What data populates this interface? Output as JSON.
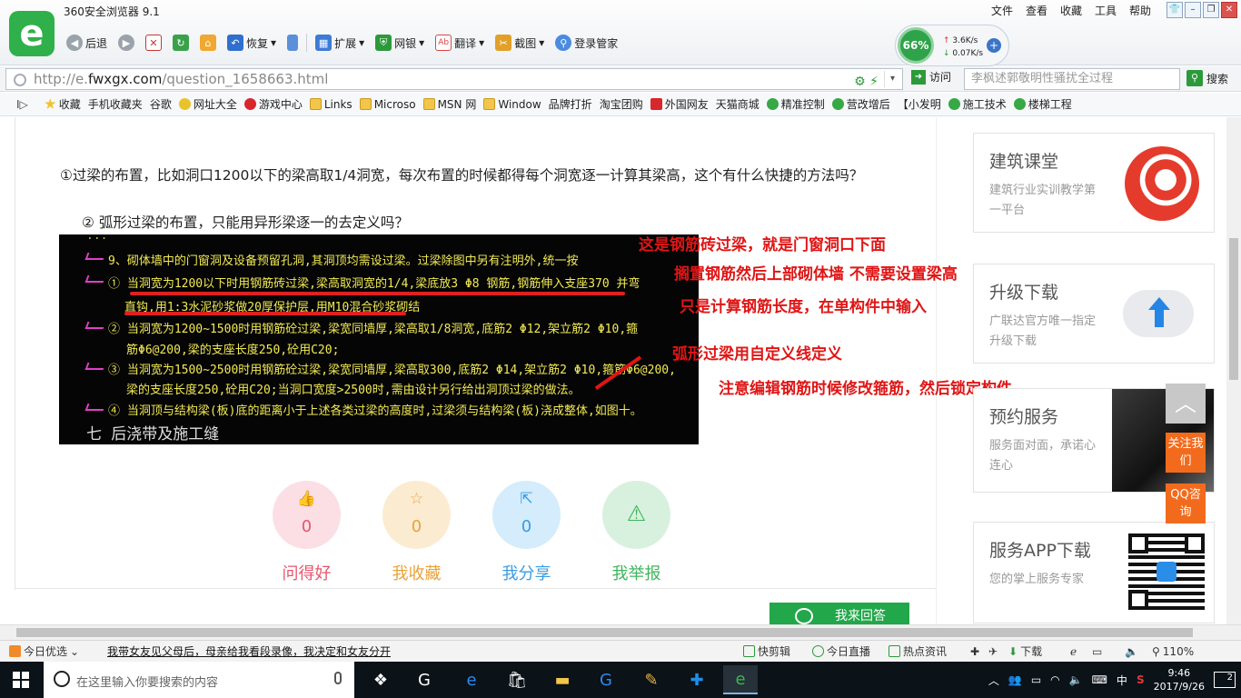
{
  "browser": {
    "title": "360安全浏览器 9.1",
    "menu": [
      "文件",
      "查看",
      "收藏",
      "工具",
      "帮助"
    ],
    "toolbar": {
      "back": "后退",
      "restore": "恢复",
      "extensions": "扩展",
      "bank": "网银",
      "translate": "翻译",
      "screenshot": "截图",
      "login": "登录管家"
    },
    "speed": {
      "percent": "66%",
      "up": "3.6K/s",
      "down": "0.07K/s"
    },
    "address": {
      "prefix": "http://e.",
      "domain": "fwxgx.com",
      "path": "/question_1658663.html"
    },
    "visit": "访问",
    "search_placeholder": "李枫述郭敬明性骚扰全过程",
    "search_button": "搜索",
    "favorites": [
      "收藏",
      "手机收藏夹",
      "谷歌",
      "网址大全",
      "游戏中心",
      "Links",
      "Microso",
      "MSN 网",
      "Window",
      "品牌打折",
      "淘宝团购",
      "外国网友",
      "天猫商城",
      "精准控制",
      "营改增后",
      "【小发明",
      "施工技术",
      "楼梯工程"
    ]
  },
  "question": {
    "line1": "①过梁的布置，比如洞口1200以下的梁高取1/4洞宽，每次布置的时候都得每个洞宽逐一计算其梁高，这个有什么快捷的方法吗？",
    "line2": "② 弧形过梁的布置，只能用异形梁逐一的去定义吗？"
  },
  "cad": {
    "lines": [
      "9、砌体墙中的门窗洞及设备预留孔洞,其洞顶均需设过梁。过梁除图中另有注明外,统一按",
      "① 当洞宽为1200以下时用钢筋砖过梁,梁高取洞宽的1/4,梁底放3 Φ8 钢筋,钢筋伸入支座370 并弯",
      "直钩,用1:3水泥砂浆做20厚保护层,用M10混合砂浆砌结",
      "② 当洞宽为1200~1500时用钢筋砼过梁,梁宽同墙厚,梁高取1/8洞宽,底筋2 Φ12,架立筋2 Φ10,箍",
      "筋Φ6@200,梁的支座长度250,砼用C20;",
      "③ 当洞宽为1500~2500时用钢筋砼过梁,梁宽同墙厚,梁高取300,底筋2 Φ14,架立筋2 Φ10,箍筋Φ6@200,",
      "梁的支座长度250,砼用C20;当洞口宽度>2500时,需由设计另行给出洞顶过梁的做法。",
      "④ 当洞顶与结构梁(板)底的距离小于上述各类过梁的高度时,过梁须与结构梁(板)浇成整体,如图十。"
    ],
    "heading": "七  后浇带及施工缝"
  },
  "annotations": [
    "这是钢筋砖过梁，就是门窗洞口下面",
    "搁置钢筋然后上部砌体墙  不需要设置梁高",
    "只是计算钢筋长度，在单构件中输入",
    "弧形过梁用自定义线定义",
    "注意编辑钢筋时候修改箍筋，然后锁定构件"
  ],
  "actions": [
    {
      "label": "问得好",
      "count": "0"
    },
    {
      "label": "我收藏",
      "count": "0"
    },
    {
      "label": "我分享",
      "count": "0"
    },
    {
      "label": "我举报",
      "count": "0"
    }
  ],
  "answer_button": "我来回答",
  "sidebar": [
    {
      "title": "建筑课堂",
      "subtitle": "建筑行业实训教学第一平台"
    },
    {
      "title": "升级下载",
      "subtitle": "广联达官方唯一指定升级下载"
    },
    {
      "title": "预约服务",
      "subtitle": "服务面对面，承诺心连心"
    },
    {
      "title": "服务APP下载",
      "subtitle": "您的掌上服务专家"
    }
  ],
  "float": {
    "follow": "关注我们",
    "qq": "QQ咨询"
  },
  "statusbar": {
    "today": "今日优选",
    "headline": "我带女友见父母后，母亲给我看段录像，我决定和女友分开",
    "kuaijian": "快剪辑",
    "live": "今日直播",
    "news": "热点资讯",
    "download": "下载",
    "zoom": "110%"
  },
  "taskbar": {
    "search_placeholder": "在这里输入你要搜索的内容",
    "ime": "中",
    "time": "9:46",
    "date": "2017/9/26",
    "notifications": "2"
  },
  "colors": {
    "accent_green": "#22a74a",
    "annotation_red": "#e01515",
    "cad_text": "#f2ea55"
  }
}
